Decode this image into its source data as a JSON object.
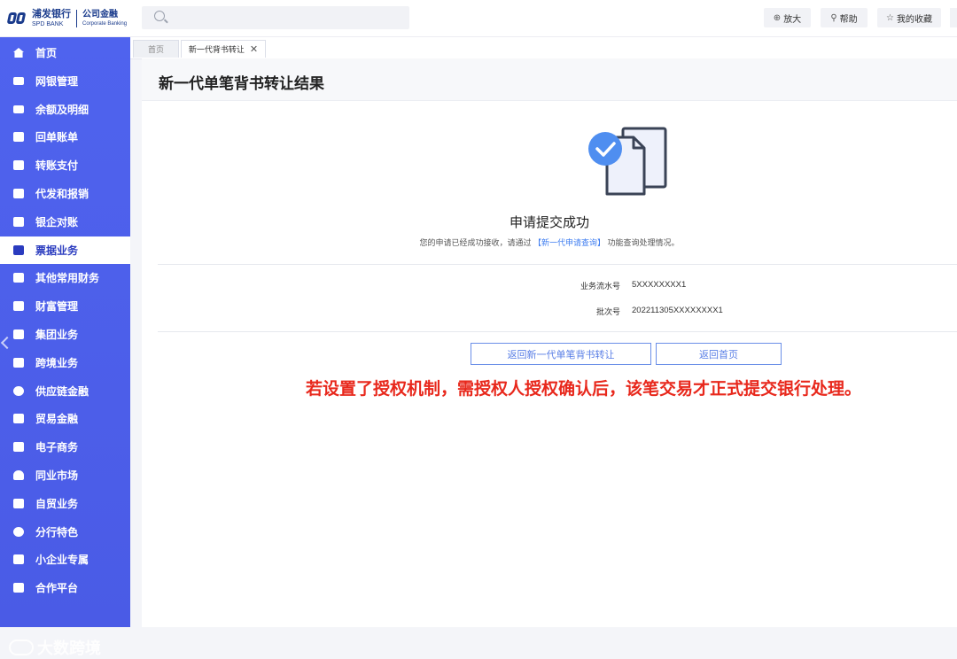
{
  "header": {
    "logo_cn": "浦发银行",
    "logo_en": "SPD BANK",
    "logo_sub_cn": "公司金融",
    "logo_sub_en": "Corporate Banking",
    "search_placeholder": "",
    "zoom_label": "放大",
    "help_label": "帮助",
    "favorites_label": "我的收藏"
  },
  "sidebar": {
    "items": [
      {
        "label": "首页",
        "icon": "home-icon"
      },
      {
        "label": "网银管理",
        "icon": "monitor-icon"
      },
      {
        "label": "余额及明细",
        "icon": "monitor-icon"
      },
      {
        "label": "回单账单",
        "icon": "document-icon"
      },
      {
        "label": "转账支付",
        "icon": "card-icon"
      },
      {
        "label": "代发和报销",
        "icon": "bag-icon"
      },
      {
        "label": "银企对账",
        "icon": "ledger-icon"
      },
      {
        "label": "票据业务",
        "icon": "bill-icon"
      },
      {
        "label": "其他常用财务",
        "icon": "grid-icon"
      },
      {
        "label": "财富管理",
        "icon": "chart-icon"
      },
      {
        "label": "集团业务",
        "icon": "building-icon"
      },
      {
        "label": "跨境业务",
        "icon": "briefcase-icon"
      },
      {
        "label": "供应链金融",
        "icon": "chain-icon"
      },
      {
        "label": "贸易金融",
        "icon": "trade-icon"
      },
      {
        "label": "电子商务",
        "icon": "cart-icon"
      },
      {
        "label": "同业市场",
        "icon": "heart-icon"
      },
      {
        "label": "自贸业务",
        "icon": "ship-icon"
      },
      {
        "label": "分行特色",
        "icon": "pin-icon"
      },
      {
        "label": "小企业专属",
        "icon": "people-icon"
      },
      {
        "label": "合作平台",
        "icon": "layers-icon"
      }
    ],
    "active_index": 7,
    "watermark": "大数跨境"
  },
  "tabs": {
    "home": "首页",
    "current": "新一代背书转让",
    "close_glyph": "✕"
  },
  "page": {
    "title": "新一代单笔背书转让结果",
    "result_title": "申请提交成功",
    "result_desc_before": "您的申请已经成功接收，请通过",
    "result_desc_link": "【新一代申请查询】",
    "result_desc_after": "功能查询处理情况。",
    "fields": [
      {
        "label": "业务流水号",
        "value": "5XXXXXXXX1"
      },
      {
        "label": "批次号",
        "value": "202211305XXXXXXXX1"
      }
    ],
    "btn_back_endorse": "返回新一代单笔背书转让",
    "btn_back_home": "返回首页",
    "annotation": "若设置了授权机制，需授权人授权确认后，该笔交易才正式提交银行处理。"
  },
  "colors": {
    "sidebar": "#4f63ee",
    "accent": "#3d7cf0",
    "annotation": "#e8281c"
  }
}
